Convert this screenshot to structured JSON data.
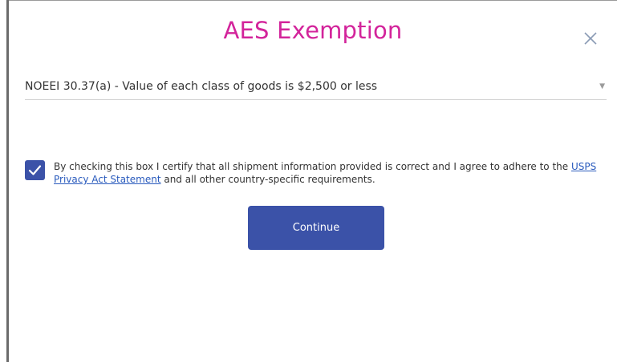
{
  "modal": {
    "title": "AES Exemption",
    "close_icon": "close-icon"
  },
  "exemption_select": {
    "selected": "NOEEI 30.37(a) - Value of each class of goods is $2,500 or less",
    "caret_icon": "chevron-down-icon"
  },
  "certification": {
    "checked": true,
    "text_before": "By checking this box I certify that all shipment information provided is correct and I agree to adhere to the ",
    "link_label": "USPS Privacy Act Statement",
    "text_after": " and all other country-specific requirements."
  },
  "actions": {
    "continue_label": "Continue"
  },
  "colors": {
    "title": "#d3249b",
    "primary": "#3b52a8",
    "link": "#2a5bbd"
  }
}
